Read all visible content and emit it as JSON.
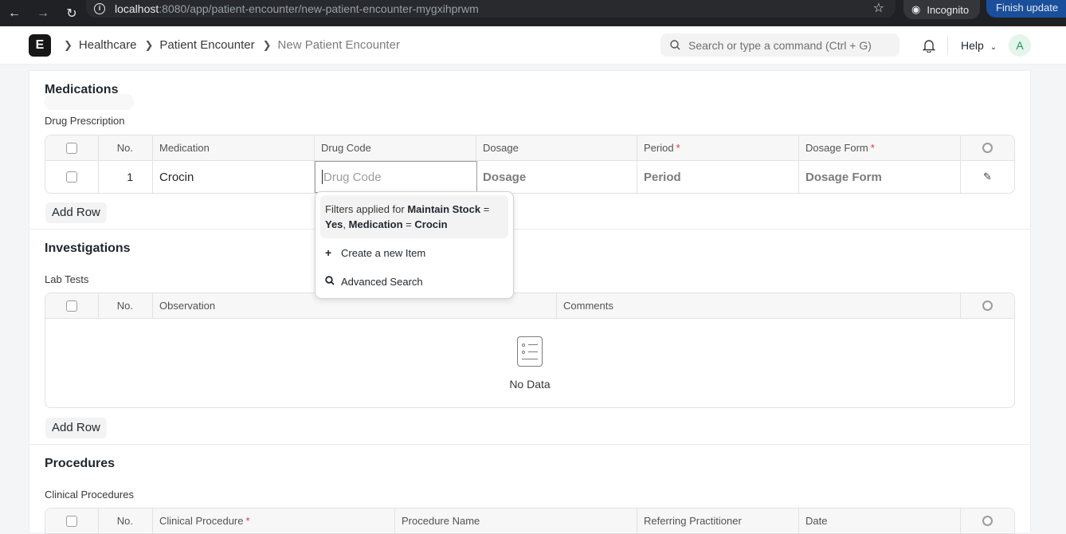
{
  "browser": {
    "url_host": "localhost",
    "url_path": ":8080/app/patient-encounter/new-patient-encounter-mygxihprwm",
    "incognito_label": "Incognito",
    "update_label": "Finish update"
  },
  "navbar": {
    "logo_letter": "E",
    "breadcrumbs": [
      "Healthcare",
      "Patient Encounter",
      "New Patient Encounter"
    ],
    "search_placeholder": "Search or type a command (Ctrl + G)",
    "help_label": "Help",
    "avatar_letter": "A"
  },
  "medications": {
    "title": "Medications",
    "table_label": "Drug Prescription",
    "headers": {
      "no": "No.",
      "medication": "Medication",
      "drug_code": "Drug Code",
      "dosage": "Dosage",
      "period": "Period",
      "dosage_form": "Dosage Form",
      "required_mark": "*"
    },
    "row": {
      "no": "1",
      "medication": "Crocin",
      "drug_code_placeholder": "Drug Code",
      "dosage_placeholder": "Dosage",
      "period_placeholder": "Period",
      "dosage_form_placeholder": "Dosage Form"
    },
    "add_row": "Add Row"
  },
  "dropdown": {
    "filter_prefix": "Filters applied for ",
    "filter1_field": "Maintain Stock",
    "filter1_eq": " = ",
    "filter1_value": "Yes",
    "filter_comma": ", ",
    "filter2_field": "Medication",
    "filter2_eq": " = ",
    "filter2_value": "Crocin",
    "create_label": "Create a new Item",
    "advanced_label": "Advanced Search"
  },
  "investigations": {
    "title": "Investigations",
    "table_label": "Lab Tests",
    "headers": {
      "no": "No.",
      "observation": "Observation",
      "comments": "Comments"
    },
    "empty_text": "No Data",
    "add_row": "Add Row"
  },
  "procedures": {
    "title": "Procedures",
    "table_label": "Clinical Procedures",
    "headers": {
      "no": "No.",
      "clinical_procedure": "Clinical Procedure",
      "procedure_name": "Procedure Name",
      "referring_practitioner": "Referring Practitioner",
      "date": "Date",
      "required_mark": "*"
    }
  }
}
